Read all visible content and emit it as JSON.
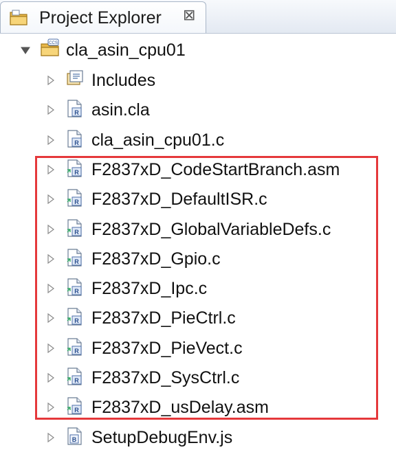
{
  "tab": {
    "title": "Project Explorer",
    "close_symbol": "⊠",
    "icon": "folder-icon"
  },
  "project": {
    "name": "cla_asin_cpu01",
    "icon": "ccs-project-icon",
    "expanded": true
  },
  "items": [
    {
      "label": "Includes",
      "icon": "includes-icon"
    },
    {
      "label": "asin.cla",
      "icon": "source-file-icon"
    },
    {
      "label": "cla_asin_cpu01.c",
      "icon": "source-file-icon"
    },
    {
      "label": "F2837xD_CodeStartBranch.asm",
      "icon": "linked-file-icon"
    },
    {
      "label": "F2837xD_DefaultISR.c",
      "icon": "linked-file-icon"
    },
    {
      "label": "F2837xD_GlobalVariableDefs.c",
      "icon": "linked-file-icon"
    },
    {
      "label": "F2837xD_Gpio.c",
      "icon": "linked-file-icon"
    },
    {
      "label": "F2837xD_Ipc.c",
      "icon": "linked-file-icon"
    },
    {
      "label": "F2837xD_PieCtrl.c",
      "icon": "linked-file-icon"
    },
    {
      "label": "F2837xD_PieVect.c",
      "icon": "linked-file-icon"
    },
    {
      "label": "F2837xD_SysCtrl.c",
      "icon": "linked-file-icon"
    },
    {
      "label": "F2837xD_usDelay.asm",
      "icon": "linked-file-icon"
    },
    {
      "label": "SetupDebugEnv.js",
      "icon": "script-file-icon"
    }
  ],
  "colors": {
    "highlight": "#e5383b",
    "tab_border": "#a8b5c7"
  }
}
